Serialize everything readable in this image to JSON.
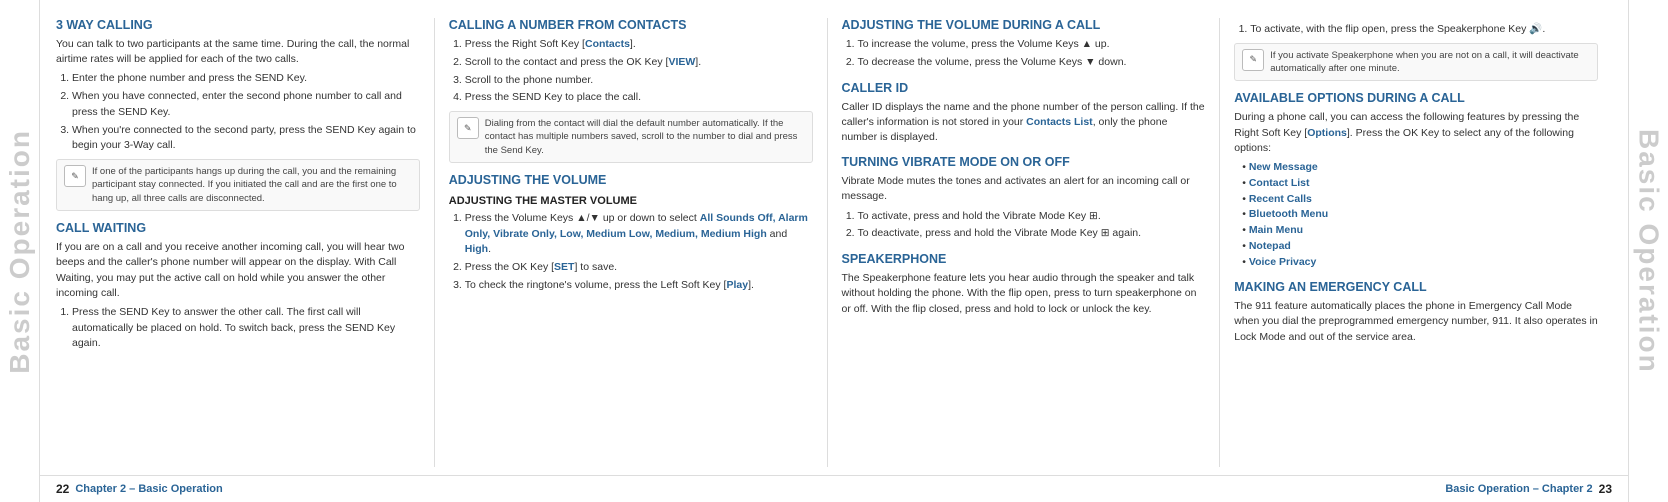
{
  "watermark": {
    "text": "Basic Operation"
  },
  "footer": {
    "left_page": "22",
    "left_chapter": "Chapter 2 – Basic Operation",
    "right_chapter": "Basic Operation – Chapter 2",
    "right_page": "23"
  },
  "col1": {
    "title1": "3 WAY CALLING",
    "intro1": "You can talk to two participants at the same time. During the call, the normal airtime rates will be applied for each of the two calls.",
    "steps1": [
      "Enter the phone number and press the SEND Key.",
      "When you have connected, enter the second phone number to call and press the SEND Key.",
      "When you're connected to the second party, press the SEND Key again to begin your 3-Way call."
    ],
    "note1": "If one of the participants hangs up during the call, you and the remaining participant stay connected. If you initiated the call and are the first one to hang up, all three calls are disconnected.",
    "title2": "CALL WAITING",
    "intro2": "If you are on a call and you receive another incoming call, you will hear two beeps and the caller's phone number will appear on the display. With Call Waiting, you may put the active call on hold while you answer the other incoming call.",
    "steps2": [
      "Press the SEND Key to answer the other call. The first call will automatically be placed on hold. To switch back, press the SEND Key again."
    ]
  },
  "col2": {
    "title1": "CALLING A NUMBER FROM CONTACTS",
    "steps1": [
      "Press the Right Soft Key [Contacts].",
      "Scroll to the contact and press the OK Key [VIEW].",
      "Scroll to the phone number.",
      "Press the SEND Key to place the call."
    ],
    "note1": "Dialing from the contact will dial the default number automatically. If the contact has multiple numbers saved, scroll to the number to dial and press the Send Key.",
    "title2": "ADJUSTING THE VOLUME",
    "subtitle1": "ADJUSTING THE MASTER VOLUME",
    "steps2_prefix": "Press the Volume Keys up or down to select ",
    "steps2_highlight": "All Sounds Off, Alarm Only, Vibrate Only, Low, Medium Low, Medium, Medium High",
    "steps2_suffix": " and High.",
    "steps2_rest": [
      "Press the OK Key [SET] to save.",
      "To check the ringtone's volume, press the Left Soft Key [Play]."
    ]
  },
  "col3": {
    "title1": "ADJUSTING THE VOLUME DURING A CALL",
    "steps1": [
      "To increase the volume, press the Volume Keys up.",
      "To decrease the volume, press the Volume Keys down."
    ],
    "title2": "CALLER ID",
    "intro2": "Caller ID displays the name and the phone number of the person calling. If the caller's information is not stored in your Contacts List, only the phone number is displayed.",
    "title3": "TURNING VIBRATE MODE ON OR OFF",
    "intro3": "Vibrate Mode mutes the tones and activates an alert for an incoming call or message.",
    "steps3": [
      "To activate, press and hold the Vibrate Mode Key.",
      "To deactivate, press and hold the Vibrate Mode Key again."
    ],
    "title4": "SPEAKERPHONE",
    "intro4": "The Speakerphone feature lets you hear audio through the speaker and talk without holding the phone. With the flip open, press to turn speakerphone on or off. With the flip closed, press and hold to lock or unlock the key."
  },
  "col4": {
    "step1_prefix": "To activate, with the flip open, press the Speakerphone Key ",
    "note1": "If you activate Speakerphone when you are not on a call, it will deactivate automatically after one minute.",
    "title1": "AVAILABLE OPTIONS DURING A CALL",
    "intro1": "During a phone call, you can access the following features by pressing the Right Soft Key [Options]. Press the OK Key to select any of the following options:",
    "options": [
      "New Message",
      "Contact List",
      "Recent Calls",
      "Bluetooth Menu",
      "Main Menu",
      "Notepad",
      "Voice Privacy"
    ],
    "title2": "MAKING AN EMERGENCY CALL",
    "intro2": "The 911 feature automatically places the phone in Emergency Call Mode when you dial the preprogrammed emergency number, 911. It also operates in Lock Mode and out of the service area."
  }
}
